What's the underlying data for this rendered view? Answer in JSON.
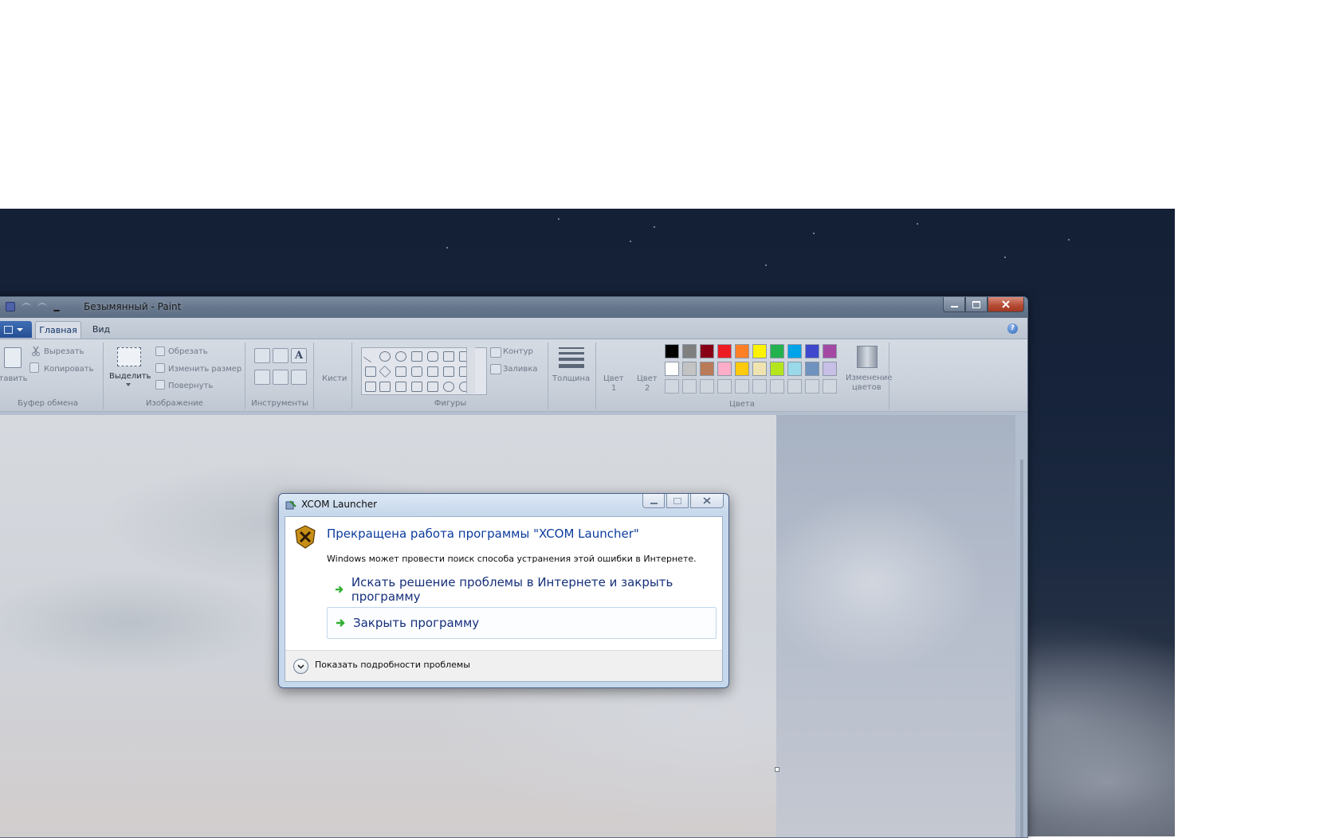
{
  "paint": {
    "title": "Безымянный - Paint",
    "tabs": {
      "home": "Главная",
      "view": "Вид"
    },
    "clipboard": {
      "paste": "ставить",
      "cut": "Вырезать",
      "copy": "Копировать",
      "label": "Буфер обмена"
    },
    "image": {
      "select": "Выделить",
      "crop": "Обрезать",
      "resize": "Изменить размер",
      "rotate": "Повернуть",
      "label": "Изображение"
    },
    "tools": {
      "label": "Инструменты",
      "text_tool": "A"
    },
    "brushes": {
      "label": "Кисти"
    },
    "shapes": {
      "outline": "Контур",
      "fill": "Заливка",
      "label": "Фигуры"
    },
    "size": {
      "label": "Толщина"
    },
    "color1": {
      "line1": "Цвет",
      "line2": "1"
    },
    "color2": {
      "line1": "Цвет",
      "line2": "2"
    },
    "edit_colors": {
      "line1": "Изменение",
      "line2": "цветов"
    },
    "colors_label": "Цвета",
    "help_glyph": "?",
    "palette_row1": [
      "#000000",
      "#7f7f7f",
      "#880015",
      "#ed1c24",
      "#ff7f27",
      "#fff200",
      "#22b14c",
      "#00a2e8",
      "#3f48cc",
      "#a349a4"
    ],
    "palette_row2": [
      "#ffffff",
      "#c3c3c3",
      "#b97a57",
      "#ffaec9",
      "#ffc90e",
      "#efe4b0",
      "#b5e61d",
      "#99d9ea",
      "#7092be",
      "#c8bfe7"
    ]
  },
  "dialog": {
    "title": "XCOM Launcher",
    "heading": "Прекращена работа программы \"XCOM Launcher\"",
    "description": "Windows может провести поиск способа устранения этой ошибки в Интернете.",
    "options": [
      {
        "label": "Искать решение проблемы в Интернете и закрыть программу"
      },
      {
        "label": "Закрыть программу"
      }
    ],
    "details": "Показать подробности проблемы",
    "colors": {
      "heading": "#0c3c9e",
      "command": "#152f7a",
      "arrow": "#2fae2f"
    }
  }
}
